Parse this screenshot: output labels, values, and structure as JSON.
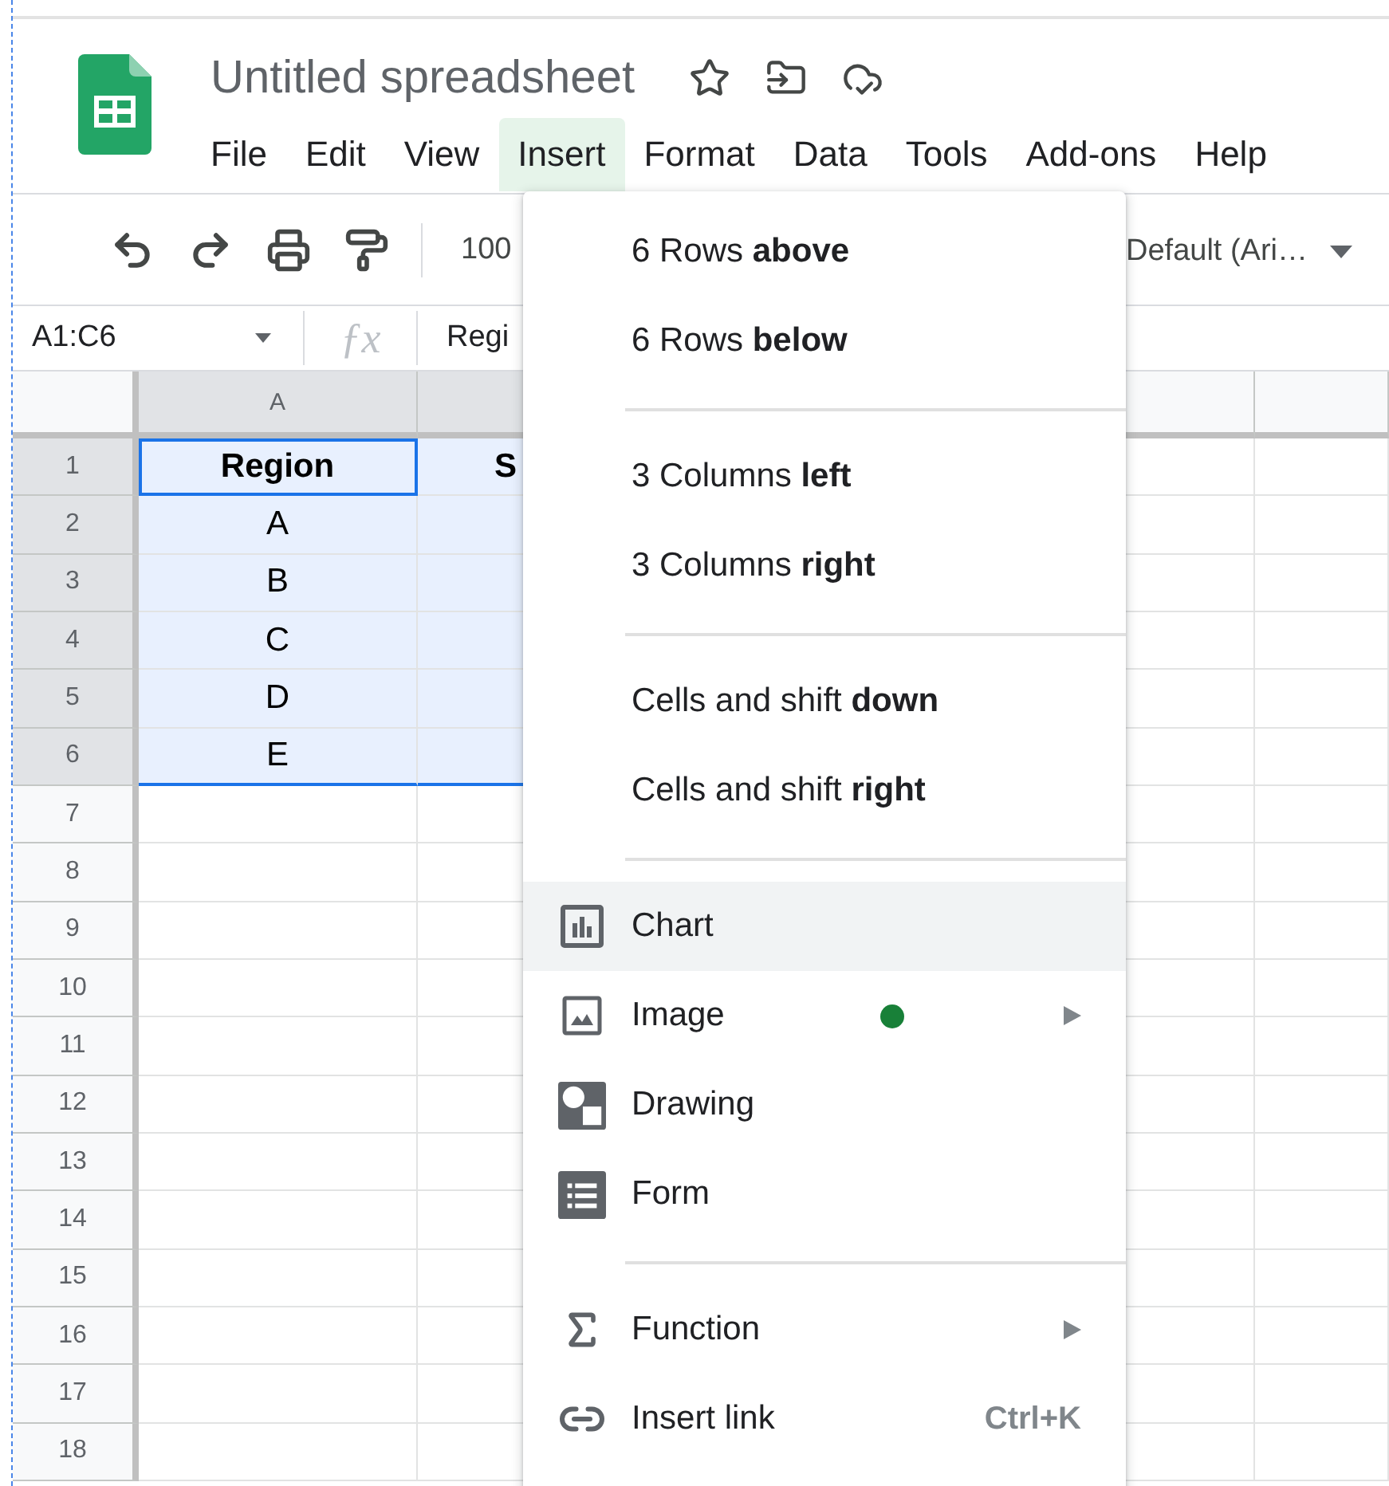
{
  "title": "Untitled spreadsheet",
  "menubar": [
    {
      "label": "File",
      "selected": false
    },
    {
      "label": "Edit",
      "selected": false
    },
    {
      "label": "View",
      "selected": false
    },
    {
      "label": "Insert",
      "selected": true
    },
    {
      "label": "Format",
      "selected": false
    },
    {
      "label": "Data",
      "selected": false
    },
    {
      "label": "Tools",
      "selected": false
    },
    {
      "label": "Add-ons",
      "selected": false
    },
    {
      "label": "Help",
      "selected": false
    }
  ],
  "toolbar": {
    "zoom": "100",
    "font": "Default (Ari…"
  },
  "formula_bar": {
    "name_box": "A1:C6",
    "fx_label": "ƒx",
    "formula": "Regi"
  },
  "columns": [
    {
      "label": "A",
      "selected": true
    },
    {
      "selected": true
    },
    {
      "selected": false
    },
    {
      "selected": false
    }
  ],
  "rows": [
    {
      "number": "1",
      "selected": true,
      "kind": "header",
      "cells": [
        {
          "text": "Region",
          "active": true
        },
        {
          "text": "S",
          "active": false
        }
      ]
    },
    {
      "number": "2",
      "selected": true,
      "kind": "data",
      "cells": [
        {
          "text": "A",
          "active": false
        }
      ]
    },
    {
      "number": "3",
      "selected": true,
      "kind": "data",
      "cells": [
        {
          "text": "B",
          "active": false
        }
      ]
    },
    {
      "number": "4",
      "selected": true,
      "kind": "data",
      "cells": [
        {
          "text": "C",
          "active": false
        }
      ]
    },
    {
      "number": "5",
      "selected": true,
      "kind": "data",
      "cells": [
        {
          "text": "D",
          "active": false
        }
      ]
    },
    {
      "number": "6",
      "selected": true,
      "kind": "data",
      "cells": [
        {
          "text": "E",
          "active": false
        }
      ]
    },
    {
      "number": "7",
      "selected": false,
      "kind": "data"
    },
    {
      "number": "8",
      "selected": false,
      "kind": "data"
    },
    {
      "number": "9",
      "selected": false,
      "kind": "data"
    },
    {
      "number": "10",
      "selected": false,
      "kind": "data"
    },
    {
      "number": "11",
      "selected": false,
      "kind": "data"
    },
    {
      "number": "12",
      "selected": false,
      "kind": "data"
    },
    {
      "number": "13",
      "selected": false,
      "kind": "data"
    },
    {
      "number": "14",
      "selected": false,
      "kind": "data"
    },
    {
      "number": "15",
      "selected": false,
      "kind": "data"
    },
    {
      "number": "16",
      "selected": false,
      "kind": "data"
    },
    {
      "number": "17",
      "selected": false,
      "kind": "data"
    },
    {
      "number": "18",
      "selected": false,
      "kind": "data"
    }
  ],
  "insert_menu": [
    {
      "kind": "text",
      "label": "6 Rows **above**",
      "selected": false
    },
    {
      "kind": "text",
      "label": "6 Rows **below**",
      "selected": false
    },
    {
      "kind": "divider"
    },
    {
      "kind": "text",
      "label": "3 Columns **left**",
      "selected": false
    },
    {
      "kind": "text",
      "label": "3 Columns **right**",
      "selected": false
    },
    {
      "kind": "divider"
    },
    {
      "kind": "text",
      "label": "Cells and shift **down**",
      "selected": false
    },
    {
      "kind": "text",
      "label": "Cells and shift **right**",
      "selected": false
    },
    {
      "kind": "divider"
    },
    {
      "kind": "chart",
      "label": "Chart",
      "selected": true,
      "submenu": false
    },
    {
      "kind": "image",
      "label": "Image",
      "selected": false,
      "submenu": true,
      "color": "#188038"
    },
    {
      "kind": "drawing",
      "label": "Drawing",
      "selected": false,
      "submenu": false
    },
    {
      "kind": "form",
      "label": "Form",
      "selected": false,
      "submenu": false
    },
    {
      "kind": "divider"
    },
    {
      "kind": "function",
      "label": "Function",
      "selected": false,
      "submenu": true
    },
    {
      "kind": "link",
      "label": "Insert link",
      "selected": false,
      "submenu": false,
      "shortcut": "Ctrl+K"
    }
  ]
}
